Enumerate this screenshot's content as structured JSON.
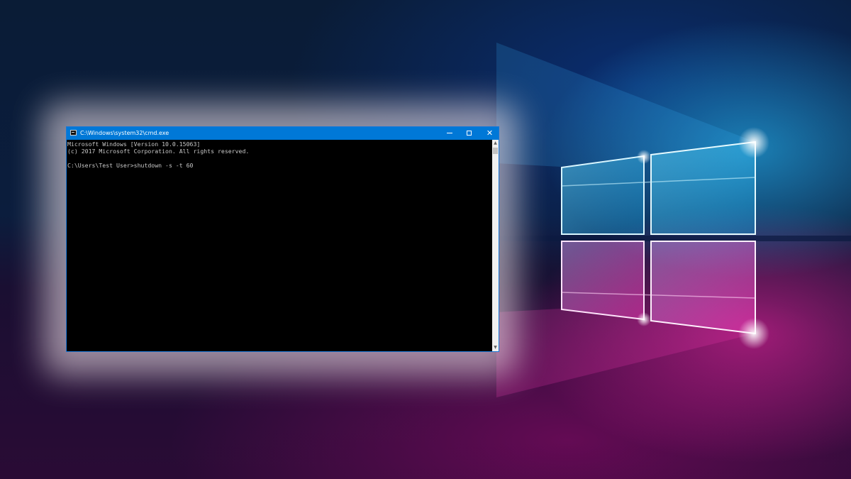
{
  "window": {
    "title": "C:\\Windows\\system32\\cmd.exe",
    "controls": {
      "minimize": "minimize",
      "maximize": "maximize",
      "close": "✕"
    },
    "icons": {
      "app_icon": "cmd-icon",
      "minimize_icon": "minimize-icon",
      "maximize_icon": "maximize-icon",
      "close_icon": "close-icon"
    },
    "accent_color": "#0078d7"
  },
  "console": {
    "lines": [
      "Microsoft Windows [Version 10.0.15063]",
      "(c) 2017 Microsoft Corporation. All rights reserved.",
      "",
      "C:\\Users\\Test User>shutdown -s -t 60"
    ],
    "text_color": "#c8c8c8",
    "background": "#000000"
  },
  "scrollbar": {
    "up_arrow": "▲",
    "down_arrow": "▼"
  },
  "wallpaper": {
    "name": "windows-hero-wallpaper",
    "colors": [
      "#0a1c36",
      "#28c8ff",
      "#ff28aa"
    ]
  }
}
